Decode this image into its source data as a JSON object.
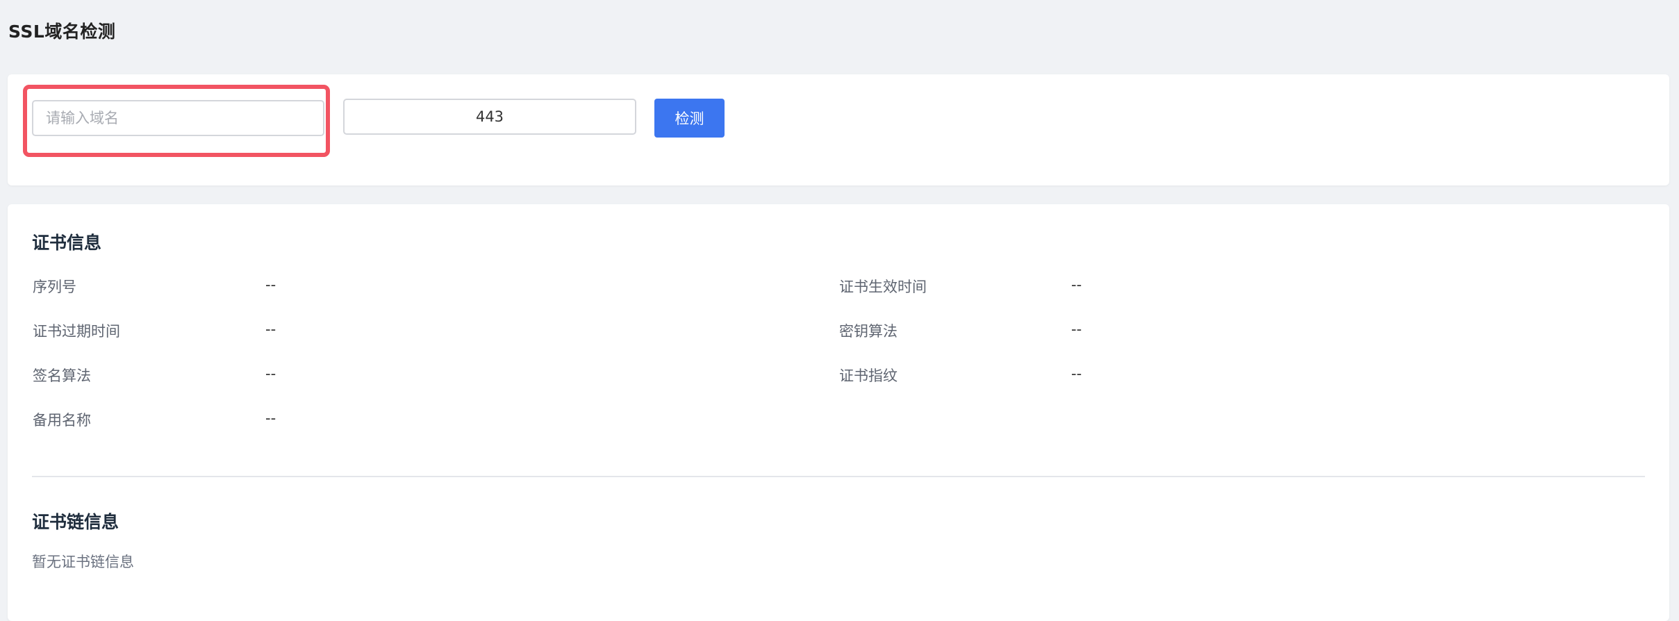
{
  "page": {
    "title": "SSL域名检测"
  },
  "search": {
    "domain_placeholder": "请输入域名",
    "domain_value": "",
    "port_value": "443",
    "check_label": "检测"
  },
  "cert_info": {
    "heading": "证书信息",
    "fields": [
      {
        "label": "序列号",
        "value": "--"
      },
      {
        "label": "证书生效时间",
        "value": "--"
      },
      {
        "label": "证书过期时间",
        "value": "--"
      },
      {
        "label": "密钥算法",
        "value": "--"
      },
      {
        "label": "签名算法",
        "value": "--"
      },
      {
        "label": "证书指纹",
        "value": "--"
      },
      {
        "label": "备用名称",
        "value": "--"
      }
    ]
  },
  "chain_info": {
    "heading": "证书链信息",
    "empty_text": "暂无证书链信息"
  },
  "colors": {
    "primary": "#3c76f0",
    "highlight": "#f25462",
    "background": "#f0f2f5"
  }
}
